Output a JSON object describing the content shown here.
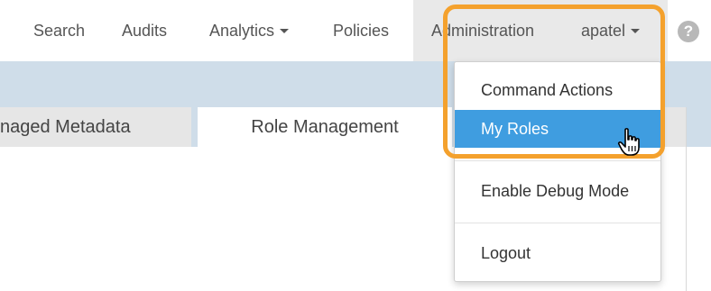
{
  "nav": {
    "search": "Search",
    "audits": "Audits",
    "analytics": "Analytics",
    "policies": "Policies",
    "administration": "Administration",
    "user": "apatel",
    "help": "?"
  },
  "tabs": [
    {
      "label": "naged Metadata"
    },
    {
      "label": "Role Management"
    }
  ],
  "dropdown": {
    "items": [
      {
        "label": "Command Actions"
      },
      {
        "label": "My Roles"
      },
      {
        "label": "Enable Debug Mode"
      },
      {
        "label": "Logout"
      }
    ]
  },
  "colors": {
    "accent": "#3f9de0",
    "highlight": "#f4a12d",
    "band": "#cfdde9"
  },
  "icons": [
    "caret-down-icon",
    "help-icon",
    "hand-pointer-icon"
  ]
}
